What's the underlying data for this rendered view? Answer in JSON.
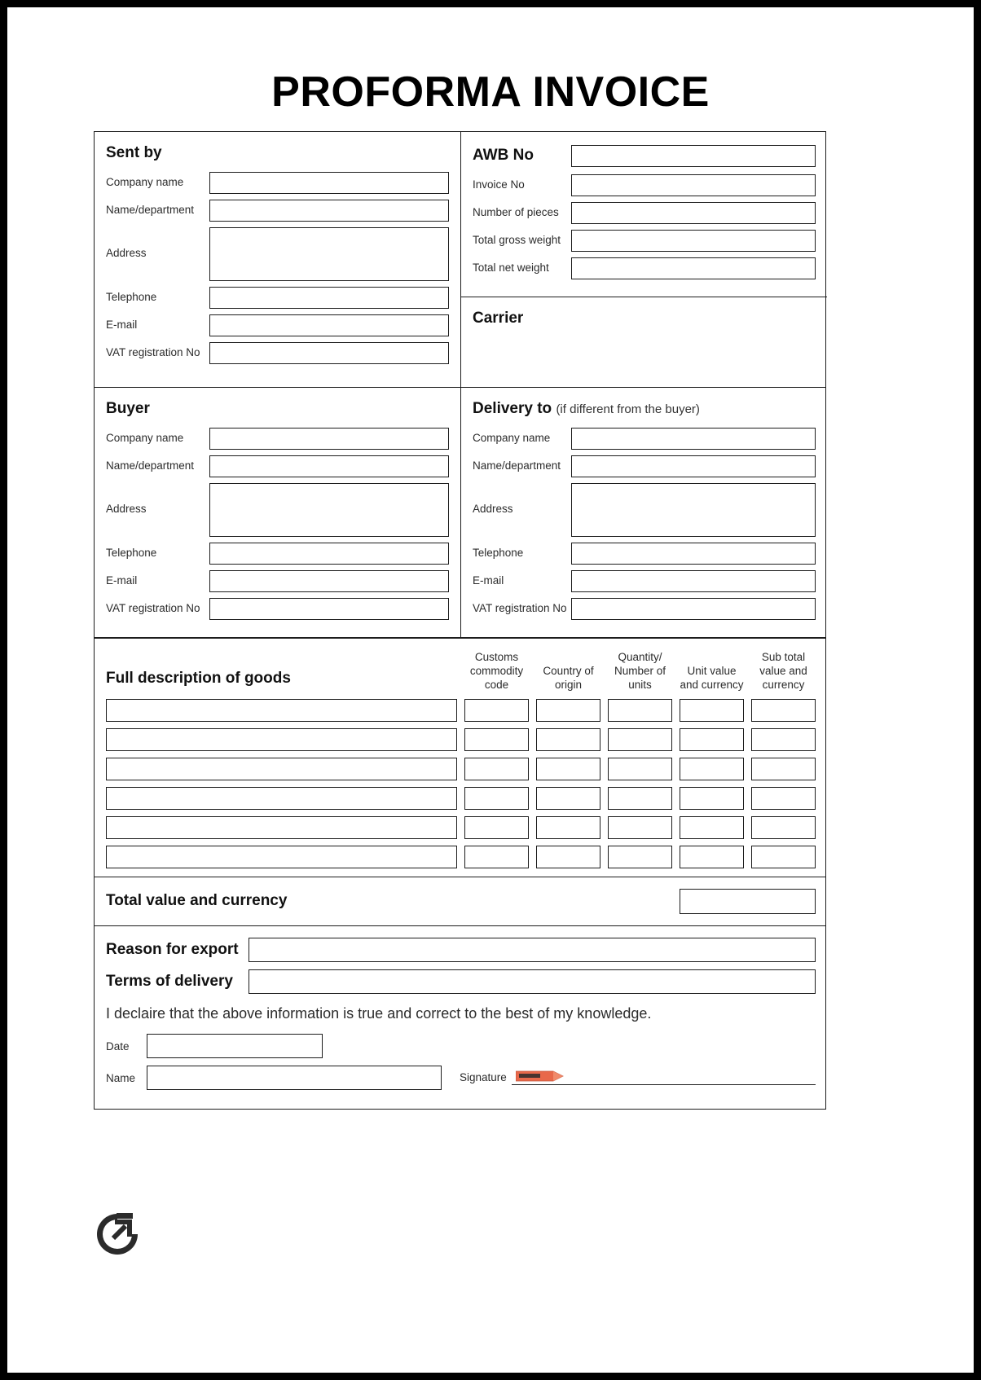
{
  "document": {
    "title": "PROFORMA INVOICE"
  },
  "sent_by": {
    "heading": "Sent by",
    "fields": [
      {
        "label": "Company name"
      },
      {
        "label": "Name/department"
      },
      {
        "label": "Address"
      },
      {
        "label": "Telephone"
      },
      {
        "label": "E-mail"
      },
      {
        "label": "VAT registration No"
      }
    ]
  },
  "shipment": {
    "heading": "AWB No",
    "fields": [
      {
        "label": "Invoice No"
      },
      {
        "label": "Number of pieces"
      },
      {
        "label": "Total gross weight"
      },
      {
        "label": "Total net weight"
      }
    ]
  },
  "carrier": {
    "heading": "Carrier"
  },
  "buyer": {
    "heading": "Buyer",
    "fields": [
      {
        "label": "Company name"
      },
      {
        "label": "Name/department"
      },
      {
        "label": "Address"
      },
      {
        "label": "Telephone"
      },
      {
        "label": "E-mail"
      },
      {
        "label": "VAT registration No"
      }
    ]
  },
  "delivery_to": {
    "heading": "Delivery to",
    "subheading": "(if different from the buyer)",
    "fields": [
      {
        "label": "Company name"
      },
      {
        "label": "Name/department"
      },
      {
        "label": "Address"
      },
      {
        "label": "Telephone"
      },
      {
        "label": "E-mail"
      },
      {
        "label": "VAT registration No"
      }
    ]
  },
  "goods": {
    "heading": "Full description of goods",
    "columns": [
      "Customs commodity code",
      "Country of origin",
      "Quantity/ Number of units",
      "Unit value and currency",
      "Sub total value and currency"
    ],
    "row_count": 6
  },
  "total": {
    "label": "Total value and currency"
  },
  "footer": {
    "reason_label": "Reason for export",
    "terms_label": "Terms of delivery",
    "declaration": "I declaire that the above information is true and correct to the best of my knowledge.",
    "date_label": "Date",
    "name_label": "Name",
    "signature_label": "Signature"
  },
  "colors": {
    "pencil_body": "#E8684A",
    "pencil_tip": "#F08A6B",
    "ink": "#1c1c1c"
  },
  "logo": {
    "name": "circular-arrow-logo"
  }
}
